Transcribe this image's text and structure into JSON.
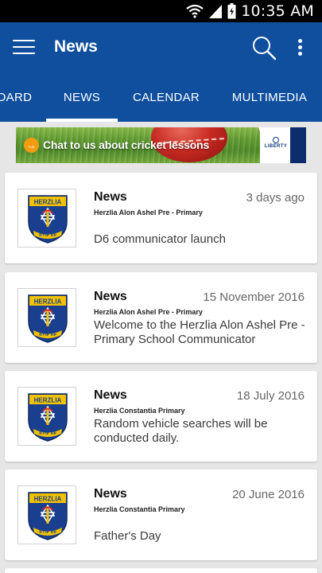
{
  "status_bar": {
    "time": "10:35 AM",
    "icons": [
      "wifi-icon",
      "signal-icon",
      "battery-icon"
    ]
  },
  "app_bar": {
    "title": "News",
    "icons": [
      "hamburger-menu-icon",
      "search-icon",
      "overflow-menu-icon"
    ]
  },
  "tabs": [
    {
      "label": "DASHBOARD",
      "visible_label": "OARD",
      "active": false
    },
    {
      "label": "NEWS",
      "active": true
    },
    {
      "label": "CALENDAR",
      "active": false
    },
    {
      "label": "MULTIMEDIA",
      "active": false
    }
  ],
  "banner": {
    "text": "Chat to us about cricket lessons",
    "brand": "LIBERTY"
  },
  "news_items": [
    {
      "title": "News",
      "date": "3 days ago",
      "school": "Herzlia Alon Ashel Pre - Primary",
      "body": "D6 communicator launch"
    },
    {
      "title": "News",
      "date": "15 November 2016",
      "school": "Herzlia Alon Ashel Pre - Primary",
      "body": "Welcome to the Herzlia Alon Ashel Pre - Primary School Communicator"
    },
    {
      "title": "News",
      "date": "18 July 2016",
      "school": "Herzlia Constantia Primary",
      "body": "Random vehicle searches will be conducted daily."
    },
    {
      "title": "News",
      "date": "20 June 2016",
      "school": "Herzlia Constantia Primary",
      "body": "Father's Day"
    }
  ],
  "logo": {
    "name": "HERZLIA",
    "motto": "עם עולם"
  },
  "colors": {
    "primary": "#0f4f9e",
    "background": "#e6e6e6",
    "card": "#ffffff",
    "crest_blue": "#1b3f8f",
    "crest_gold": "#f2c200"
  }
}
